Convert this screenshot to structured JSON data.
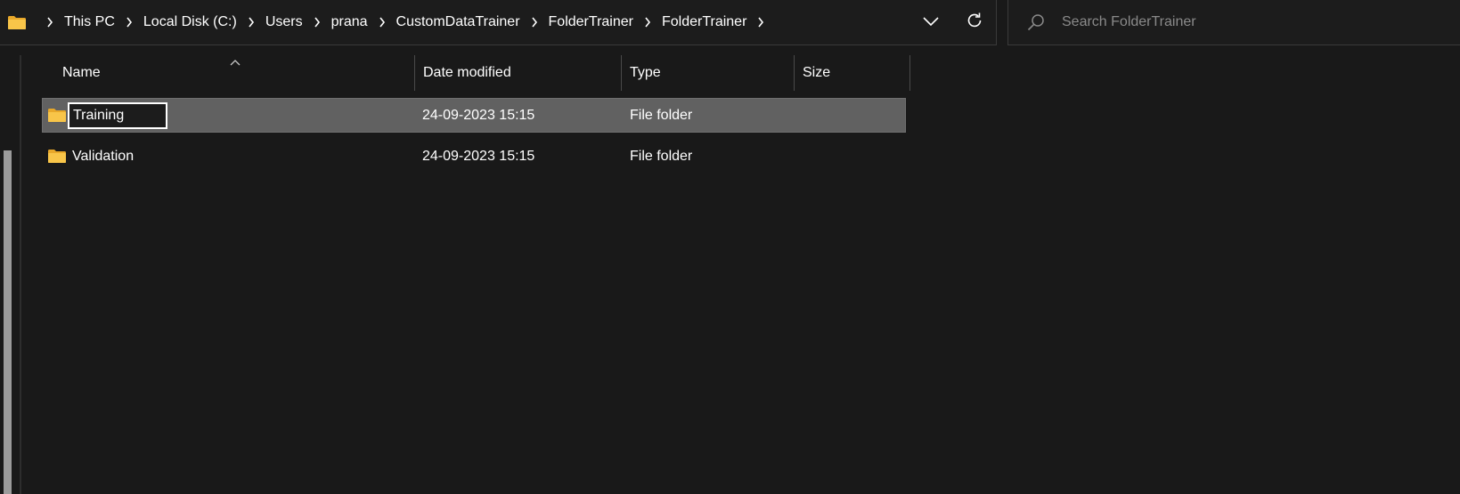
{
  "breadcrumb": {
    "items": [
      {
        "label": "This PC"
      },
      {
        "label": "Local Disk (C:)"
      },
      {
        "label": "Users"
      },
      {
        "label": "prana"
      },
      {
        "label": "CustomDataTrainer"
      },
      {
        "label": "FolderTrainer"
      },
      {
        "label": "FolderTrainer"
      }
    ],
    "icons": {
      "root": "folder-icon",
      "separator": "chevron-right-icon",
      "dropdown": "chevron-down-icon",
      "refresh": "refresh-icon"
    }
  },
  "search": {
    "placeholder": "Search FolderTrainer",
    "value": "",
    "icon": "search-icon"
  },
  "columns": {
    "name": "Name",
    "date_modified": "Date modified",
    "type": "Type",
    "size": "Size",
    "sort_indicator": "sort-ascending-icon"
  },
  "files": [
    {
      "name": "Training",
      "date_modified": "24-09-2023 15:15",
      "type": "File folder",
      "size": "",
      "selected": true,
      "renaming": true,
      "icon": "folder-icon"
    },
    {
      "name": "Validation",
      "date_modified": "24-09-2023 15:15",
      "type": "File folder",
      "size": "",
      "selected": false,
      "renaming": false,
      "icon": "folder-icon"
    }
  ],
  "colors": {
    "background": "#191919",
    "selection": "#616161",
    "folder_yellow": "#f8c549",
    "text": "#ffffff",
    "placeholder": "#8a8a8a"
  }
}
